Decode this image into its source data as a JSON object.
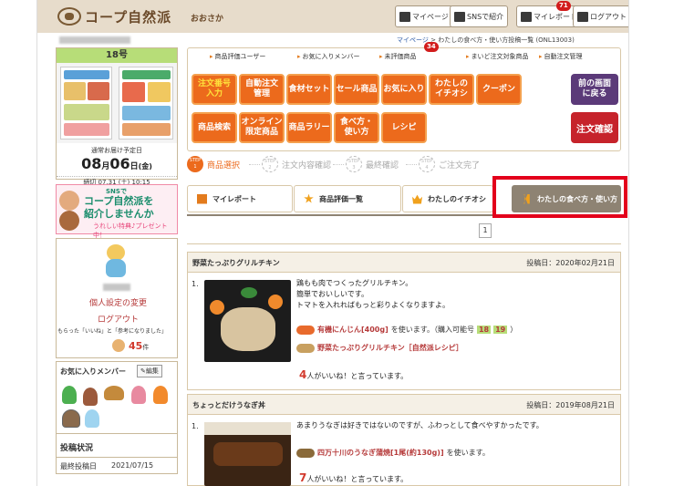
{
  "header": {
    "logo_text": "コープ自然派",
    "area": "おおさか",
    "buttons": [
      "マイページ",
      "SNSで紹介",
      "マイレポート",
      "ログアウト"
    ],
    "report_badge": "71"
  },
  "breadcrumb": {
    "parent": "マイページ",
    "sep": ">",
    "current": "わたしの食べ方・使い方投稿一覧 (ONL13003)"
  },
  "sidebar": {
    "issue": "18号",
    "delivery_label": "通常お届け予定日",
    "delivery_month": "08",
    "delivery_day": "06",
    "month_unit": "月",
    "day_unit": "日",
    "delivery_weekday": "(金)",
    "deadline": "締切  07.31 (土) 10:15",
    "sns_banner": {
      "line1": "SNSで",
      "line2": "コープ自然派を",
      "line3": "紹介しませんか",
      "line4": "うれしい特典♪プレゼント中！"
    },
    "profile_link": "個人設定の変更",
    "logout_link": "ログアウト",
    "likes_text": "もらった「いいね」と「参考になりました」",
    "likes_count": "45",
    "likes_unit": "件",
    "fav_title": "お気に入りメンバー",
    "fav_edit": "編集",
    "post_status": "投稿状況",
    "last_post_label": "最終投稿日",
    "last_post_date": "2021/07/15"
  },
  "menu": {
    "categories": [
      "商品評価ユーザー",
      "お気に入りメンバー",
      "未評価商品",
      "まいど注文対象商品",
      "自動注文管理"
    ],
    "unrated_badge": "34",
    "row1": [
      "注文番号\n入力",
      "自動注文\n管理",
      "食材セット",
      "セール商品",
      "お気に入り",
      "わたしの\nイチオシ",
      "クーポン"
    ],
    "row2": [
      "商品検索",
      "オンライン\n限定商品",
      "商品ラリー",
      "食べ方・\n使い方",
      "レシピ"
    ],
    "back_button": "前の画面\nに戻る",
    "confirm_button": "注文確認"
  },
  "steps": [
    {
      "num": "STEP\n1",
      "label": "商品選択"
    },
    {
      "num": "STEP\n2",
      "label": "注文内容確認"
    },
    {
      "num": "STEP\n3",
      "label": "最終確認"
    },
    {
      "num": "STEP\n4",
      "label": "ご注文完了"
    }
  ],
  "tabs": [
    "マイレポート",
    "商品評価一覧",
    "わたしのイチオシ",
    "わたしの食べ方・使い方"
  ],
  "pager": "1",
  "posts": [
    {
      "title": "野菜たっぷりグリルチキン",
      "date": "投稿日：2020年02月21日",
      "num": "1.",
      "body": "鶏もも肉でつくったグリルチキン。\n簡単でおいしいです。\nトマトを入れればもっと彩りよくなりますよ。",
      "product1": "有機にんじん[400g]",
      "product1_suffix": "を使います。（購入可能号",
      "issue_a": "18",
      "issue_b": "19",
      "product1_end": "）",
      "product2": "野菜たっぷりグリルチキン［自然派レシピ］",
      "likes": "4",
      "likes_text": "人がいいね！と言っています。"
    },
    {
      "title": "ちょっとだけうなぎ丼",
      "date": "投稿日：2019年08月21日",
      "num": "1.",
      "body": "あまりうなぎは好きではないのですが、ふわっとして食べやすかったです。",
      "product1": "四万十川のうなぎ蒲焼[1尾(約130g)]",
      "product1_suffix": "を使います。",
      "likes": "7",
      "likes_text": "人がいいね！と言っています。"
    }
  ],
  "colors": {
    "orange": "#ec6a1c",
    "purple": "#5b3a79",
    "red": "#c6232b",
    "highlight": "#e3001b",
    "tab_active": "#8e8373",
    "header": "#e7dccb"
  }
}
